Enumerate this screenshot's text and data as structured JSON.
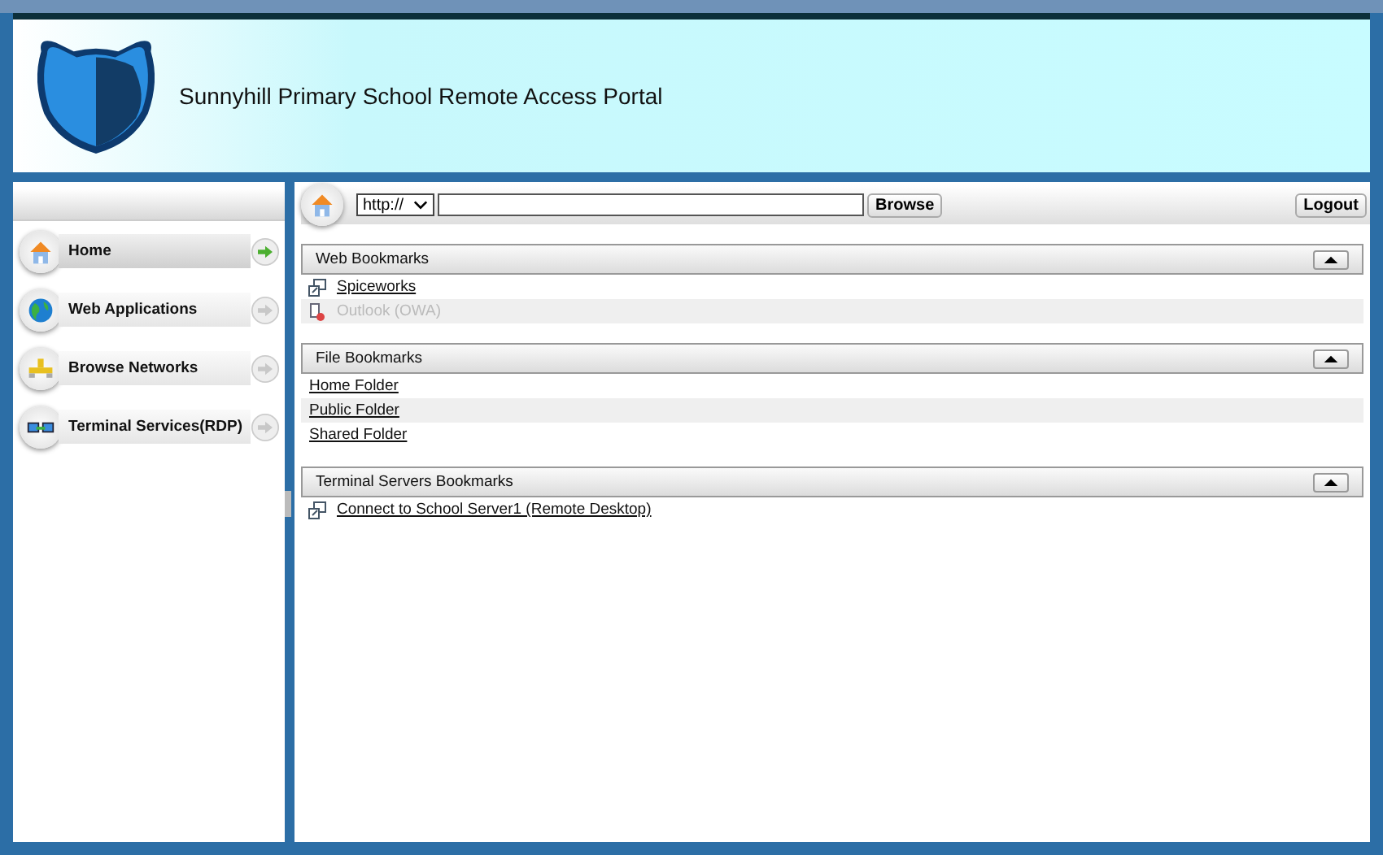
{
  "header": {
    "title": "Sunnyhill Primary School Remote Access Portal"
  },
  "sidebar": {
    "items": [
      {
        "label": "Home",
        "kind": "home",
        "selected": true
      },
      {
        "label": "Web Applications",
        "kind": "globe",
        "selected": false
      },
      {
        "label": "Browse Networks",
        "kind": "network",
        "selected": false
      },
      {
        "label": "Terminal Services(RDP)",
        "kind": "monitor",
        "selected": false
      }
    ]
  },
  "toolbar": {
    "protocol": "http://",
    "browse": "Browse",
    "logout": "Logout"
  },
  "sections": [
    {
      "title": "Web Bookmarks",
      "items": [
        {
          "label": "Spiceworks",
          "kind": "web",
          "disabled": false
        },
        {
          "label": "Outlook (OWA)",
          "kind": "web-broken",
          "disabled": true
        }
      ]
    },
    {
      "title": "File Bookmarks",
      "items": [
        {
          "label": "Home Folder",
          "kind": "file",
          "disabled": false
        },
        {
          "label": "Public Folder",
          "kind": "file",
          "disabled": false
        },
        {
          "label": "Shared Folder",
          "kind": "file",
          "disabled": false
        }
      ]
    },
    {
      "title": "Terminal Servers Bookmarks",
      "items": [
        {
          "label": "Connect to School Server1 (Remote Desktop)",
          "kind": "web",
          "disabled": false
        }
      ]
    }
  ]
}
